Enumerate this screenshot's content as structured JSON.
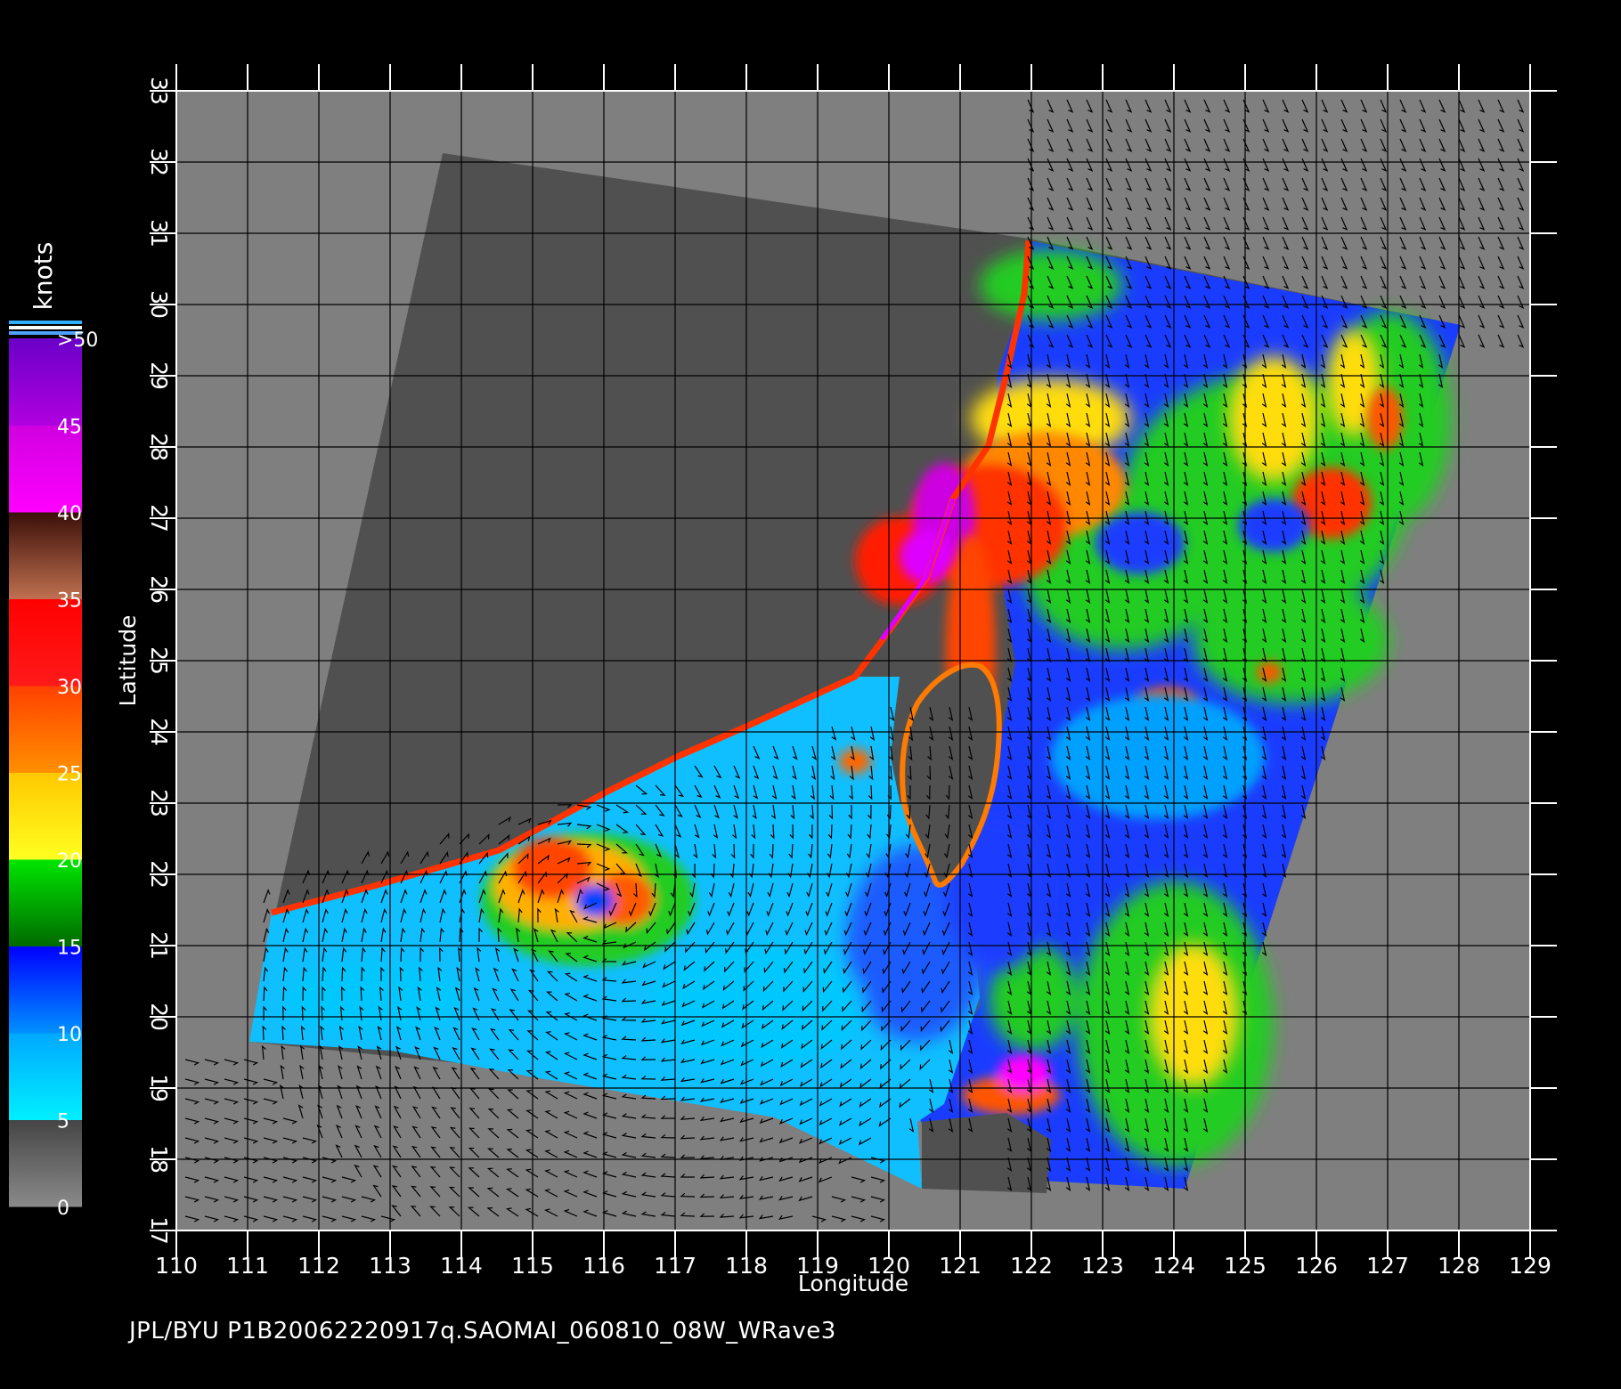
{
  "map": {
    "x_axis_label": "Longitude",
    "y_axis_label": "Latitude",
    "lon_ticks": [
      "110",
      "111",
      "112",
      "113",
      "114",
      "115",
      "116",
      "117",
      "118",
      "119",
      "120",
      "121",
      "122",
      "123",
      "124",
      "125",
      "126",
      "127",
      "128",
      "129"
    ],
    "lat_ticks": [
      "17",
      "18",
      "19",
      "20",
      "21",
      "22",
      "23",
      "24",
      "25",
      "26",
      "27",
      "28",
      "29",
      "30",
      "31",
      "32",
      "33"
    ],
    "lon_range": [
      110,
      129
    ],
    "lat_range": [
      17,
      33
    ],
    "grid": true,
    "background_color": "#7f7f7f",
    "swath_land_color": "#505050"
  },
  "colorbar": {
    "unit_label": "knots",
    "tick_labels": [
      ">50",
      "45",
      "40",
      "35",
      "30",
      "25",
      "20",
      "15",
      "10",
      "5",
      "0"
    ],
    "segments": [
      {
        "range": [
          0,
          5
        ],
        "top": "#454545",
        "bottom": "#8a8a8a"
      },
      {
        "range": [
          5,
          10
        ],
        "top": "#00a8ff",
        "bottom": "#00f0ff"
      },
      {
        "range": [
          10,
          15
        ],
        "top": "#0000ff",
        "bottom": "#0090ff"
      },
      {
        "range": [
          15,
          20
        ],
        "top": "#00e600",
        "bottom": "#006a00"
      },
      {
        "range": [
          20,
          25
        ],
        "top": "#ffc800",
        "bottom": "#ffff20"
      },
      {
        "range": [
          25,
          30
        ],
        "top": "#ff4000",
        "bottom": "#ff9000"
      },
      {
        "range": [
          30,
          35
        ],
        "top": "#ff0000",
        "bottom": "#ff1a1a"
      },
      {
        "range": [
          35,
          40
        ],
        "top": "#3a0e08",
        "bottom": "#c07050"
      },
      {
        "range": [
          40,
          45
        ],
        "top": "#d000e0",
        "bottom": "#ff00ff"
      },
      {
        "range": [
          45,
          50
        ],
        "top": "#6a00c8",
        "bottom": "#b000e0"
      }
    ],
    "top_stripes": [
      "#30b0ff",
      "#ffffff",
      "#50a0ff"
    ]
  },
  "footer": {
    "text": "JPL/BYU  P1B20062220917q.SAOMAI_060810_08W_WRave3"
  }
}
